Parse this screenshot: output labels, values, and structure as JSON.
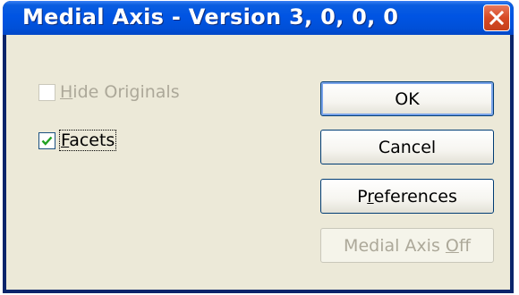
{
  "window": {
    "title": "Medial Axis - Version 3, 0, 0, 0"
  },
  "checkboxes": [
    {
      "label_mnemonic": "H",
      "label_rest": "ide Originals",
      "checked": false,
      "enabled": false
    },
    {
      "label_mnemonic": "F",
      "label_rest": "acets",
      "checked": true,
      "enabled": true
    }
  ],
  "buttons": {
    "ok": "OK",
    "cancel": "Cancel",
    "preferences_pre": "P",
    "preferences_mnemonic": "r",
    "preferences_post": "eferences",
    "medial_axis_off_pre": "Medial Axis ",
    "medial_axis_off_mnemonic": "O",
    "medial_axis_off_post": "ff"
  },
  "colors": {
    "titlebar": "#0054e3",
    "face": "#ece9d8",
    "close": "#d74a25"
  }
}
